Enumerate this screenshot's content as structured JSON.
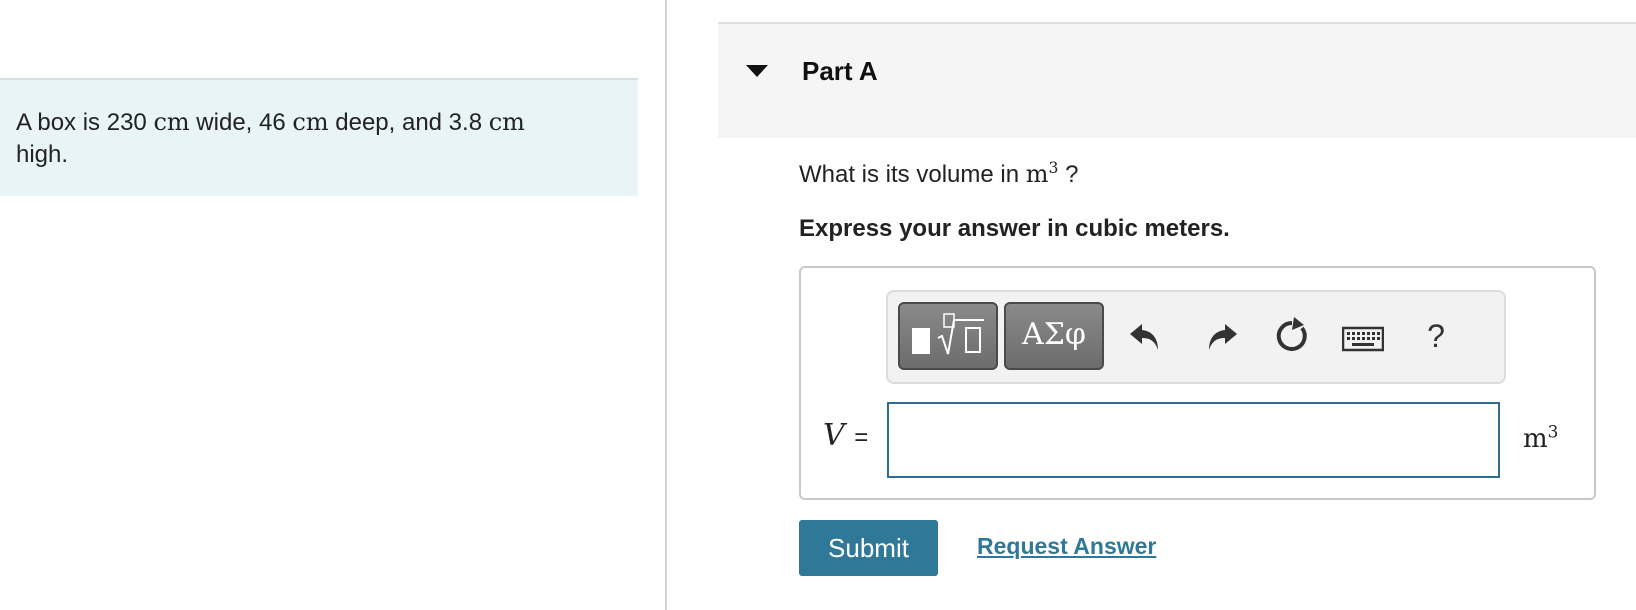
{
  "problem": {
    "text_start": "A box is 230 ",
    "unit_1": "cm",
    "text_mid1": " wide, 46 ",
    "unit_2": "cm",
    "text_mid2": " deep, and 3.8 ",
    "unit_3": "cm",
    "text_end": " high."
  },
  "part": {
    "title": "Part A",
    "question_prefix": "What is its volume in ",
    "question_unit": "m",
    "question_unit_exp": "3",
    "question_suffix": " ?",
    "instruction": "Express your answer in cubic meters."
  },
  "toolbar": {
    "greek_label": "ΑΣφ",
    "help_label": "?",
    "icons": [
      "templates-icon",
      "undo-icon",
      "redo-icon",
      "reset-icon",
      "keyboard-icon",
      "help-icon"
    ]
  },
  "answer": {
    "variable": "V",
    "equals": "=",
    "value": "",
    "unit": "m",
    "unit_exp": "3"
  },
  "actions": {
    "submit_label": "Submit",
    "request_label": "Request Answer"
  },
  "colors": {
    "problem_bg": "#e8f4f6",
    "accent": "#2f7897",
    "input_border": "#2d6f8c"
  }
}
